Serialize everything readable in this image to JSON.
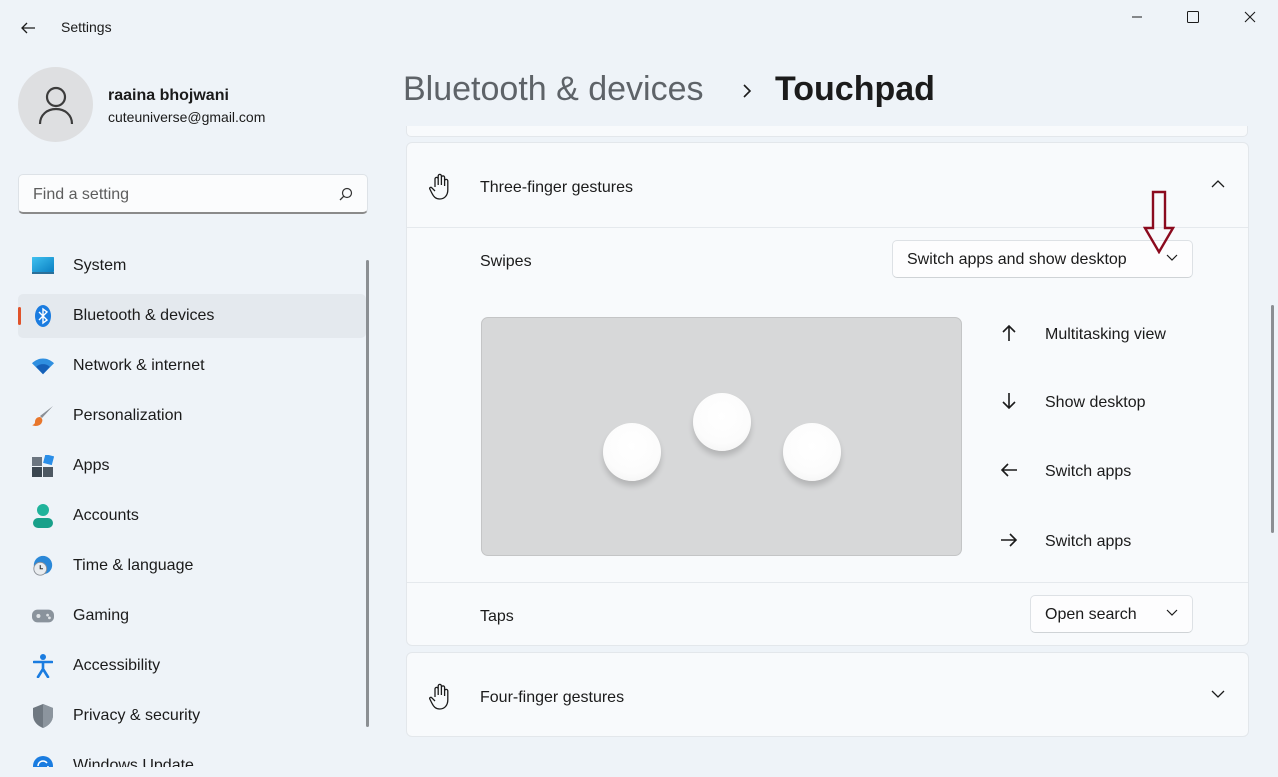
{
  "window": {
    "title": "Settings",
    "back_icon": "back-arrow-icon",
    "minimize_icon": "minimize-icon",
    "maximize_icon": "maximize-icon",
    "close_icon": "close-icon"
  },
  "profile": {
    "name": "raaina bhojwani",
    "email": "cuteuniverse@gmail.com"
  },
  "search": {
    "placeholder": "Find a setting"
  },
  "sidebar": {
    "items": [
      {
        "label": "System",
        "icon": "system-icon"
      },
      {
        "label": "Bluetooth & devices",
        "icon": "bluetooth-icon",
        "active": true
      },
      {
        "label": "Network & internet",
        "icon": "wifi-icon"
      },
      {
        "label": "Personalization",
        "icon": "paintbrush-icon"
      },
      {
        "label": "Apps",
        "icon": "apps-icon"
      },
      {
        "label": "Accounts",
        "icon": "accounts-icon"
      },
      {
        "label": "Time & language",
        "icon": "time-language-icon"
      },
      {
        "label": "Gaming",
        "icon": "gamepad-icon"
      },
      {
        "label": "Accessibility",
        "icon": "accessibility-icon"
      },
      {
        "label": "Privacy & security",
        "icon": "shield-icon"
      },
      {
        "label": "Windows Update",
        "icon": "update-icon"
      }
    ]
  },
  "breadcrumb": {
    "parent": "Bluetooth & devices",
    "current": "Touchpad"
  },
  "three_finger": {
    "title": "Three-finger gestures",
    "swipes_label": "Swipes",
    "swipes_value": "Switch apps and show desktop",
    "actions": [
      {
        "direction": "up",
        "label": "Multitasking view"
      },
      {
        "direction": "down",
        "label": "Show desktop"
      },
      {
        "direction": "left",
        "label": "Switch apps"
      },
      {
        "direction": "right",
        "label": "Switch apps"
      }
    ],
    "taps_label": "Taps",
    "taps_value": "Open search"
  },
  "four_finger": {
    "title": "Four-finger gestures"
  },
  "colors": {
    "accent_indicator": "#e0532b",
    "annotation_arrow": "#8b0a1e"
  }
}
